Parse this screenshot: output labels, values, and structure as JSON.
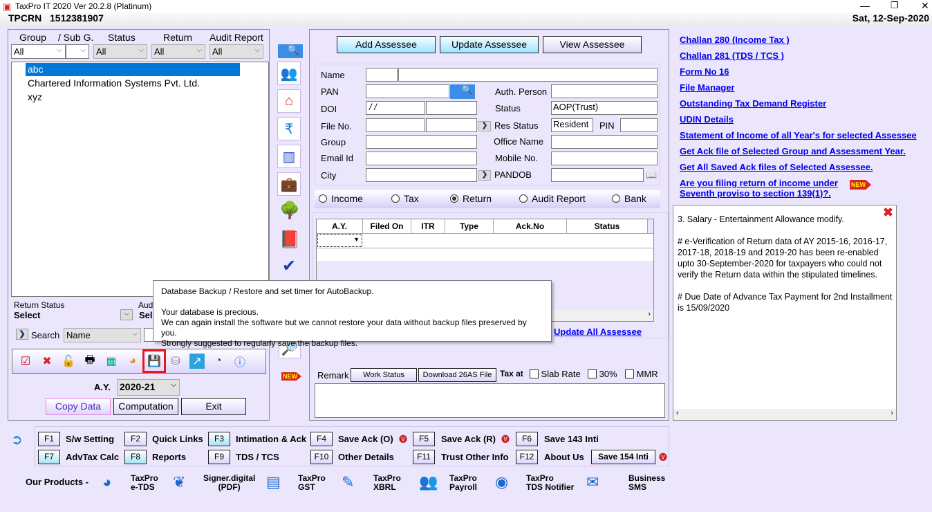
{
  "window": {
    "title": "TaxPro IT 2020 Ver 20.2.8 (Platinum)",
    "minimize": "—",
    "restore": "❐",
    "close": "✕"
  },
  "toolbar": {
    "label": "TPCRN",
    "value": "1512381907",
    "date": "Sat, 12-Sep-2020"
  },
  "filters": {
    "group_label": "Group",
    "subg_label": "/ Sub G.",
    "status_label": "Status",
    "return_label": "Return",
    "audit_label": "Audit Report",
    "group": "All",
    "subg": "",
    "status": "All",
    "return": "All",
    "audit": "All"
  },
  "assessees": [
    {
      "name": "abc",
      "selected": true
    },
    {
      "name": "Chartered Information Systems Pvt. Ltd."
    },
    {
      "name": "xyz"
    }
  ],
  "return_status": {
    "label": "Return Status",
    "value": "Select",
    "audit_label": "Aud",
    "audit_value": "Sel"
  },
  "search": {
    "label": "Search",
    "field": "Name"
  },
  "left_tools": [
    "check-icon",
    "delete-icon",
    "lock-icon",
    "print-icon",
    "calculator-icon",
    "pie-chart-icon",
    "backup-restore-icon",
    "database-icon",
    "export-icon",
    "help-icon",
    "info-icon"
  ],
  "ay": {
    "label": "A.Y.",
    "value": "2020-21"
  },
  "left_buttons": {
    "copy": "Copy Data",
    "computation": "Computation",
    "exit": "Exit"
  },
  "tooltip": {
    "title": "Database Backup / Restore and set timer for AutoBackup.",
    "line1": "Your database is precious.",
    "line2": "We can again install the software but we cannot restore your data without backup files preserved by you.",
    "line3": "Strongly suggested to regularly save the backup files."
  },
  "side_icons": [
    "search-icon",
    "users-icon",
    "home-icon",
    "rupee-icon",
    "chart-icon",
    "briefcase-icon",
    "tree-icon",
    "book-icon",
    "check-mark-icon",
    "magnifier-icon",
    "new-icon"
  ],
  "top_buttons": {
    "add": "Add Assessee",
    "update": "Update Assessee",
    "view": "View Assessee"
  },
  "form": {
    "name": "Name",
    "pan": "PAN",
    "doi": "DOI",
    "doi_value": " / /",
    "file_no": "File No.",
    "group": "Group",
    "email": "Email Id",
    "city": "City",
    "auth": "Auth. Person",
    "status": "Status",
    "status_value": "AOP(Trust)",
    "res_status": "Res Status",
    "res_value": "Resident",
    "pin": "PIN",
    "office": "Office Name",
    "mobile": "Mobile No.",
    "pandob": "PANDOB"
  },
  "radios": {
    "options": [
      "Income",
      "Tax",
      "Return",
      "Audit Report",
      "Bank"
    ],
    "selected": "Return"
  },
  "table": {
    "columns": [
      "A.Y.",
      "Filed On",
      "ITR",
      "Type",
      "Ack.No",
      "Status"
    ]
  },
  "update_all": "Update All Assessee",
  "remark": {
    "label": "Remark",
    "work_status": "Work Status",
    "download": "Download 26AS File",
    "tax_at": "Tax at",
    "slab": "Slab Rate",
    "thirty": "30%",
    "mmr": "MMR"
  },
  "links": [
    "Challan 280 (Income Tax )",
    "Challan 281 (TDS / TCS )",
    "Form No 16",
    "File Manager",
    "Outstanding Tax Demand Register",
    "UDIN Details",
    "Statement of Income of all Year's for selected Assessee",
    "Get Ack file of Selected Group and Assessment Year.",
    "Get All Saved Ack files of Selected Assessee."
  ],
  "link_new1": "Are you filing return of income under",
  "link_new2": "Seventh proviso to section 139(1)?.",
  "new_badge": "NEW",
  "notice": {
    "p1": "3. Salary - Entertainment Allowance modify.",
    "p2": "# e-Verification of Return data of AY 2015-16, 2016-17, 2017-18, 2018-19 and 2019-20 has been re-enabled upto 30-September-2020 for taxpayers who could not verify the Return data within the stipulated timelines.",
    "p3": "# Due Date of Advance Tax Payment for 2nd Installment is 15/09/2020"
  },
  "fkeys": [
    {
      "key": "F1",
      "label": "S/w Setting"
    },
    {
      "key": "F2",
      "label": "Quick Links"
    },
    {
      "key": "F3",
      "label": "Intimation & Ack"
    },
    {
      "key": "F4",
      "label": "Save Ack (O)"
    },
    {
      "key": "F5",
      "label": "Save Ack (R)"
    },
    {
      "key": "F6",
      "label": "Save 143 Inti"
    },
    {
      "key": "F7",
      "label": "AdvTax Calc"
    },
    {
      "key": "F8",
      "label": "Reports"
    },
    {
      "key": "F9",
      "label": "TDS / TCS"
    },
    {
      "key": "F10",
      "label": "Other Details"
    },
    {
      "key": "F11",
      "label": "Trust Other Info"
    },
    {
      "key": "F12",
      "label": "About Us"
    }
  ],
  "save154": "Save 154 Inti",
  "products": {
    "label": "Our Products -",
    "items": [
      [
        "TaxPro",
        "e-TDS"
      ],
      [
        "Signer.digital",
        "(PDF)"
      ],
      [
        "TaxPro",
        "GST"
      ],
      [
        "TaxPro",
        "XBRL"
      ],
      [
        "TaxPro",
        "Payroll"
      ],
      [
        "TaxPro",
        "TDS Notifier"
      ],
      [
        "Business",
        "SMS"
      ]
    ]
  }
}
